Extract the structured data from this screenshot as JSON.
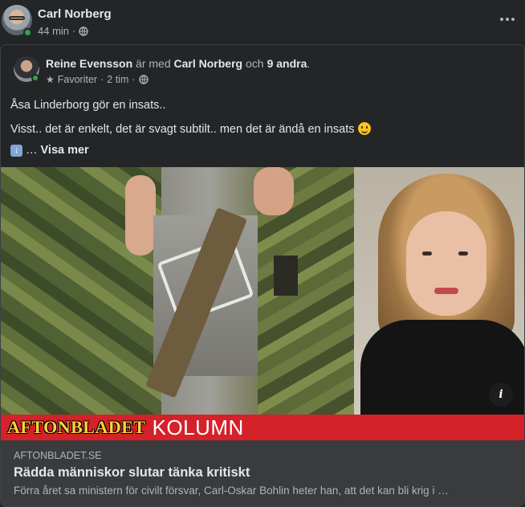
{
  "post": {
    "author": "Carl Norberg",
    "time": "44 min",
    "separator": "·"
  },
  "shared": {
    "author": "Reine Evensson",
    "with_text": "är med",
    "tagged": "Carl Norberg",
    "and_text": "och",
    "others": "9 andra",
    "period": ".",
    "audience": "Favoriter",
    "time": "2 tim",
    "separator": "·"
  },
  "text": {
    "line1": "Åsa Linderborg gör en insats..",
    "line2": "Visst.. det är enkelt, det är svagt subtilt.. men det är ändå en insats",
    "ellipsis": "…",
    "see_more": "Visa mer"
  },
  "image": {
    "brand": "AFTONBLADET",
    "section": "KOLUMN"
  },
  "link": {
    "domain": "AFTONBLADET.SE",
    "title": "Rädda människor slutar tänka kritiskt",
    "description": "Förra året sa ministern för civilt försvar, Carl-Oskar Bohlin heter han, att det kan bli krig i …"
  },
  "icons": {
    "globe": "globe-icon",
    "star": "star-icon",
    "more": "more-options-icon",
    "info": "info-icon",
    "smile": "smile-emoji-icon",
    "down_arrow": "down-arrow-emoji-icon"
  },
  "colors": {
    "background": "#242526",
    "text_primary": "#e4e6eb",
    "text_secondary": "#b0b3b8",
    "online": "#31a24c",
    "link_footer": "#3a3b3c",
    "aftonbladet_red": "#d4212a",
    "aftonbladet_yellow": "#f5d63b"
  }
}
